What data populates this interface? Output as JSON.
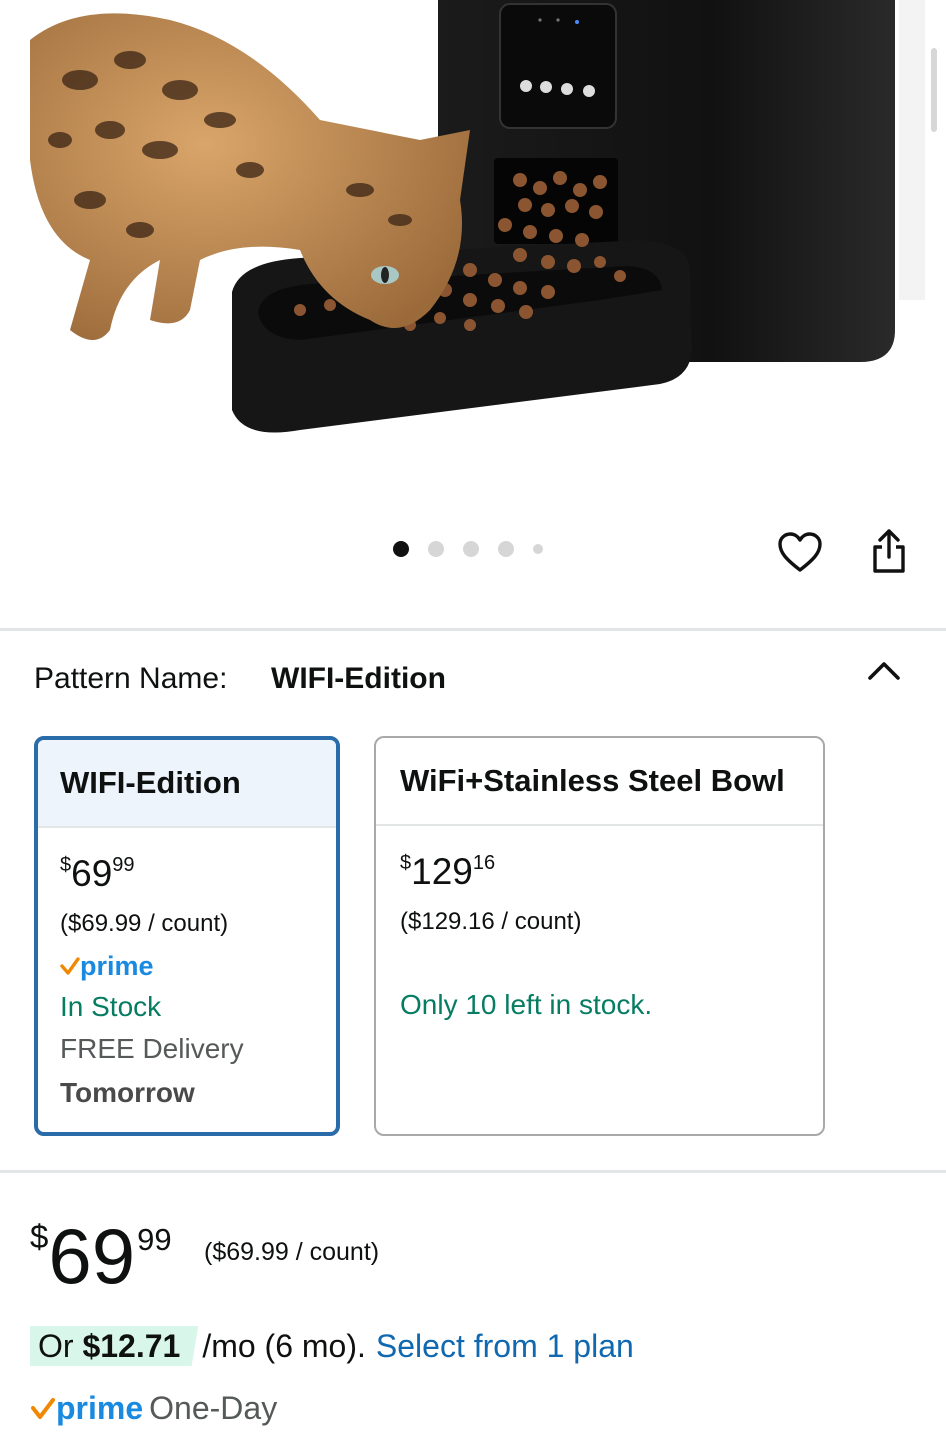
{
  "gallery": {
    "image_alt": "Automatic pet feeder with cat eating from bowl",
    "slide_count": 5,
    "active_slide": 1
  },
  "pattern": {
    "label": "Pattern Name:",
    "value": "WIFI-Edition"
  },
  "options": [
    {
      "name": "WIFI-Edition",
      "price_symbol": "$",
      "price_whole": "69",
      "price_cents": "99",
      "unit_price": "($69.99 / count)",
      "prime": "prime",
      "stock": "In Stock",
      "delivery": "FREE Delivery",
      "delivery_day": "Tomorrow",
      "selected": true
    },
    {
      "name": "WiFi+Stainless Steel Bowl",
      "price_symbol": "$",
      "price_whole": "129",
      "price_cents": "16",
      "unit_price": "($129.16 / count)",
      "stock": "Only 10 left in stock.",
      "selected": false
    }
  ],
  "price": {
    "symbol": "$",
    "whole": "69",
    "cents": "99",
    "unit_price": "($69.99 / count)"
  },
  "financing": {
    "or": "Or",
    "amount": "$12.71",
    "term": "/mo (6 mo).",
    "link": "Select from 1 plan"
  },
  "shipping": {
    "prime": "prime",
    "speed": "One-Day"
  },
  "colors": {
    "accent_blue": "#2a6ba9",
    "prime_blue": "#1a8ae0",
    "stock_green": "#067d62",
    "link_blue": "#1068b0",
    "prime_check_orange": "#f08804"
  }
}
